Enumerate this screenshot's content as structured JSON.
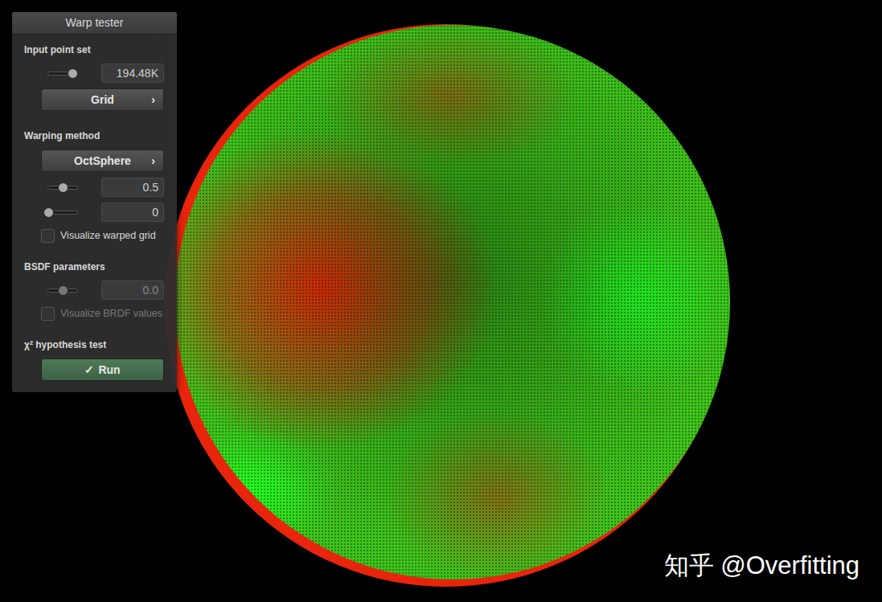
{
  "panel": {
    "title": "Warp tester",
    "input_point_set": {
      "label": "Input point set",
      "slider": {
        "level": 0.84,
        "value": "194.48K",
        "disabled": false
      },
      "dropdown": {
        "label": "Grid",
        "chevron": "›"
      }
    },
    "warping_method": {
      "label": "Warping method",
      "dropdown": {
        "label": "OctSphere",
        "chevron": "›"
      },
      "sliders": [
        {
          "level": 0.5,
          "value": "0.5",
          "disabled": false
        },
        {
          "level": 0,
          "value": "0",
          "disabled": false
        }
      ],
      "checkbox": {
        "label": "Visualize warped grid",
        "checked": false,
        "disabled": false
      }
    },
    "bsdf": {
      "label": "BSDF parameters",
      "slider": {
        "level": 0.5,
        "value": "0.0",
        "disabled": true
      },
      "checkbox": {
        "label": "Visualize BRDF values",
        "checked": false,
        "disabled": true
      }
    },
    "test": {
      "label": "χ² hypothesis test",
      "button": {
        "icon": "✓",
        "label": "Run"
      }
    }
  },
  "watermark": {
    "text": "知乎 @Overfitting"
  }
}
